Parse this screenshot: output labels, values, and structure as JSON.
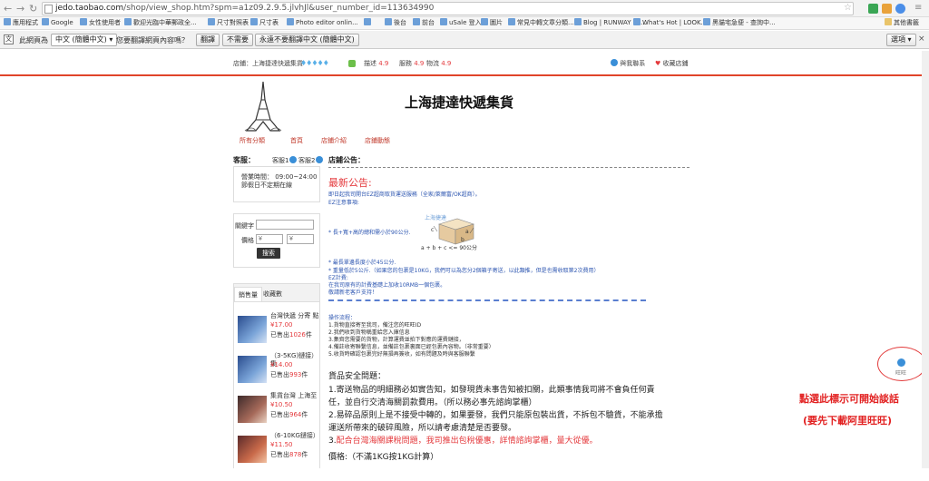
{
  "browser": {
    "url_host": "jedo.taobao.com",
    "url_path": "/shop/view_shop.htm?spm=a1z09.2.9.5.jlvhJl&user_number_id=113634990"
  },
  "bookmarks": [
    "應用程式",
    "Google",
    "女性使用者",
    "歡迎光臨中華郵政全...",
    "尺寸對照表",
    "尺寸表",
    "Photo editor onlin...",
    "",
    "後台",
    "前台",
    "uSale 登入",
    "圖片",
    "常見中轉文章分類...",
    "Blog | RUNWAY ch...",
    "What's Hot | LOOK...",
    "黑貓宅急便 - 查詢中...",
    "其他書籤"
  ],
  "translate_bar": {
    "prefix": "此網頁為",
    "lang": "中文 (簡體中文)",
    "question": "您要翻譯網頁內容嗎？",
    "translate": "翻譯",
    "no": "不需要",
    "never": "永遠不要翻譯中文 (簡體中文)",
    "options": "選項"
  },
  "shop_bar": {
    "store_label": "店鋪：上海捷達快遞集貨",
    "diamonds": "♦♦♦♦♦",
    "desc_label": "描述",
    "desc_score": "4.9",
    "service_label": "服務",
    "service_score": "4.9",
    "logistics_label": "物流",
    "logistics_score": "4.9",
    "contact": "與我聯系",
    "favorite": "收藏店鋪"
  },
  "header": {
    "title": "上海捷達快遞集貨",
    "nav": [
      "所有分類",
      "首頁",
      "店鋪介紹",
      "店鋪動態"
    ]
  },
  "sidebar": {
    "service_title": "客服：",
    "service_1": "客服1",
    "service_2": "客服2",
    "hours_label": "營業時間：",
    "hours": "09:00~24:00",
    "holiday": "節假日不定期在線",
    "keyword_label": "關鍵字",
    "price_label": "價格",
    "price_from_ph": "¥",
    "price_to_ph": "¥",
    "search_button": "搜索",
    "tab_sales": "銷售量",
    "tab_fav": "收藏數",
    "products": [
      {
        "name": "台灣快遞 分寄 點",
        "price": "¥17.00",
        "sold_prefix": "已售出",
        "sold": "1026",
        "sold_suffix": "件"
      },
      {
        "name": "（3-5KG)鏈接）集",
        "price": "¥14.00",
        "sold_prefix": "已售出",
        "sold": "993",
        "sold_suffix": "件"
      },
      {
        "name": "集貨台灣 上海至",
        "price": "¥10.50",
        "sold_prefix": "已售出",
        "sold": "964",
        "sold_suffix": "件"
      },
      {
        "name": "（6-10KG鏈接）",
        "price": "¥11.50",
        "sold_prefix": "已售出",
        "sold": "878",
        "sold_suffix": "件"
      }
    ]
  },
  "notice": {
    "title": "店鋪公告：",
    "latest": "最新公告:",
    "line1": "即日起我司開台EZ超商取貨運送服務（全家/萊爾富/OK超商）。",
    "line2": "EZ注意事項:",
    "box_label": "上海捷達",
    "box_c": "c",
    "box_a": "a",
    "box_b": "b",
    "box_formula": "a + b + c <= 90公分",
    "line3": "* 長+寬+高的總和需小於90公分.",
    "line4": "* 最長單邊長度小於45公分.",
    "line5": "* 重量低於5公斤.（如果您的包裹是10KG，我們可以為您分2個箱子寄送，以此類推，但是也需收取第2次費用）",
    "line6": "EZ計費:",
    "line7": "在我司原有的計費基礎上加收10RMB一個包裹。",
    "line8": "敬請新老客戶支持！",
    "process_title": "操作流程：",
    "steps": [
      "1.貨物直接寄至我司，備注您的旺旺ID",
      "2.我們收到貨物稱重給您入庫信息",
      "3.集齊您需要的貨物，計算運費並拍下對應的運費鏈接，",
      "4.備註收寄聯繫信息，並備註包裹裏面已經包裹內容物。（非常重要）",
      "5.收貨時確認包裹完好無損再簽收，如有問題及時與客服聯繫"
    ],
    "safety_title": "貨品安全問題：",
    "safety1a": "1.寄送物品的明細務必如實告知，如發現貨未事告知被扣關，此類事情我司將不會負任何責",
    "safety1b": "任，並自行交清海關罰款費用。（所以務必事先諮詢掌櫃）",
    "safety2a": "2.易碎品原則上是不接受中轉的，如果要發，我們只能原包裝出貨，不拆包不驗貨，不能承擔",
    "safety2b": "運送所帶來的破碎風險，所以請考慮清楚是否要發。",
    "safety3_prefix": "3.",
    "safety3": "配合台灣海關課稅問題，我司推出包稅優惠，詳情諮詢掌櫃，量大從優。",
    "price_line": "價格:（不滿1KG按1KG計算）"
  },
  "overlay": {
    "wangwang": "旺旺",
    "anno1": "點選此標示可開始談話",
    "anno2": "(要先下載阿里旺旺)"
  },
  "colors": {
    "accent_red": "#e4393c",
    "link_blue": "#2c55b0",
    "annotation_red": "#e22222"
  }
}
